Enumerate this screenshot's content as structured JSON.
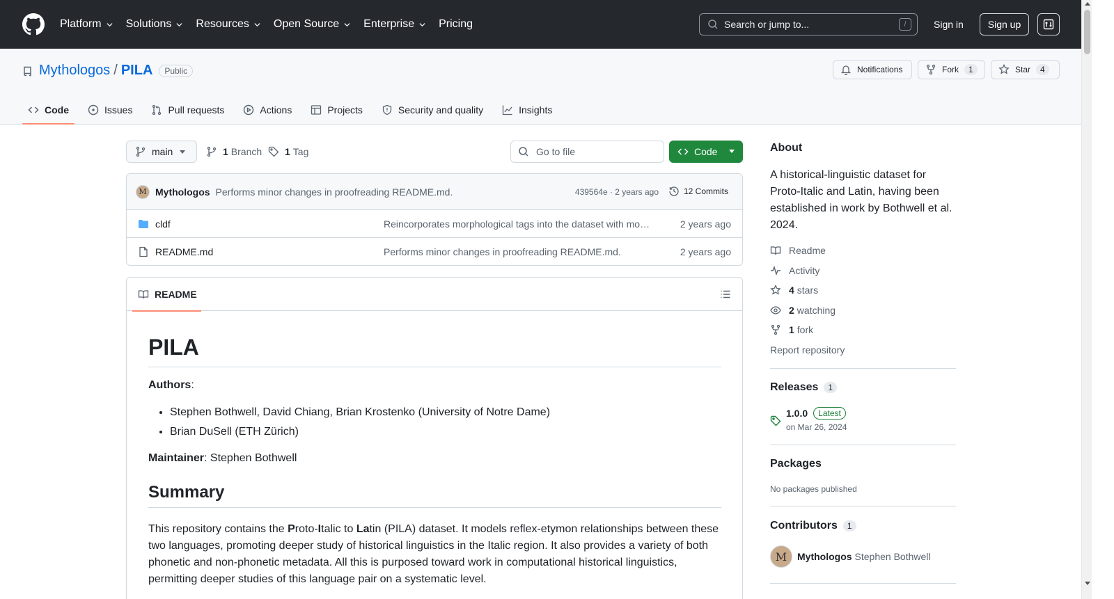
{
  "header": {
    "nav": [
      {
        "label": "Platform",
        "has_dropdown": true
      },
      {
        "label": "Solutions",
        "has_dropdown": true
      },
      {
        "label": "Resources",
        "has_dropdown": true
      },
      {
        "label": "Open Source",
        "has_dropdown": true
      },
      {
        "label": "Enterprise",
        "has_dropdown": true
      },
      {
        "label": "Pricing",
        "has_dropdown": false
      }
    ],
    "search_placeholder": "Search or jump to...",
    "search_shortcut": "/",
    "sign_in": "Sign in",
    "sign_up": "Sign up",
    "icons": {
      "logo": "github-mark-icon",
      "menu": "command-palette-icon"
    }
  },
  "repo": {
    "owner": "Mythologos",
    "separator": "/",
    "name": "PILA",
    "visibility": "Public",
    "notifications_label": "Notifications",
    "fork_label": "Fork",
    "fork_count": "1",
    "star_label": "Star",
    "star_count": "4"
  },
  "tabs": [
    {
      "label": "Code",
      "icon": "code-icon",
      "active": true
    },
    {
      "label": "Issues",
      "icon": "issue-icon",
      "active": false
    },
    {
      "label": "Pull requests",
      "icon": "pull-request-icon",
      "active": false
    },
    {
      "label": "Actions",
      "icon": "play-icon",
      "active": false
    },
    {
      "label": "Projects",
      "icon": "table-icon",
      "active": false
    },
    {
      "label": "Security and quality",
      "icon": "shield-icon",
      "active": false
    },
    {
      "label": "Insights",
      "icon": "graph-icon",
      "active": false
    }
  ],
  "toolbar": {
    "branch": "main",
    "branch_count": "1",
    "branch_label": "Branch",
    "tag_count": "1",
    "tag_label": "Tag",
    "goto_placeholder": "Go to file",
    "code_button": "Code"
  },
  "latest_commit": {
    "author": "Mythologos",
    "message": "Performs minor changes in proofreading README.md.",
    "hash_and_time": "439564e · 2 years ago",
    "commits_label": "12 Commits"
  },
  "files": [
    {
      "name": "cldf",
      "type": "folder",
      "message": "Reincorporates morphological tags into the dataset with more information",
      "date": "2 years ago"
    },
    {
      "name": "README.md",
      "type": "file",
      "message": "Performs minor changes in proofreading README.md.",
      "date": "2 years ago"
    }
  ],
  "readme": {
    "tab_label": "README",
    "h1": "PILA",
    "authors_label": "Authors",
    "authors": [
      "Stephen Bothwell, David Chiang, Brian Krostenko (University of Notre Dame)",
      "Brian DuSell (ETH Zürich)"
    ],
    "maintainer_label": "Maintainer",
    "maintainer": "Stephen Bothwell",
    "h2": "Summary",
    "summary_parts": {
      "a": "This repository contains the ",
      "b1": "P",
      "c1": "roto-",
      "b2": "I",
      "c2": "talic to ",
      "b3": "La",
      "c3": "tin (PILA) dataset. It models reflex-etymon relationships between these two languages, promoting deeper study of historical linguistics in the Italic region. It also provides a variety of both phonetic and non-phonetic metadata. All this is purposed toward work in computational historical linguistics, permitting deeper studies of this language pair on a systematic level."
    }
  },
  "sidebar": {
    "about_title": "About",
    "description": "A historical-linguistic dataset for Proto-Italic and Latin, having been established in work by Bothwell et al. 2024.",
    "links": [
      {
        "icon": "book-icon",
        "bold": "",
        "label": "Readme"
      },
      {
        "icon": "pulse-icon",
        "bold": "",
        "label": "Activity"
      },
      {
        "icon": "star-icon",
        "bold": "4",
        "label": "stars"
      },
      {
        "icon": "eye-icon",
        "bold": "2",
        "label": "watching"
      },
      {
        "icon": "fork-icon",
        "bold": "1",
        "label": "fork"
      }
    ],
    "report": "Report repository",
    "releases_title": "Releases",
    "releases_count": "1",
    "release_version": "1.0.0",
    "release_badge": "Latest",
    "release_date": "on Mar 26, 2024",
    "packages_title": "Packages",
    "packages_empty": "No packages published",
    "contributors_title": "Contributors",
    "contributors_count": "1",
    "contributor_login": "Mythologos",
    "contributor_name": "Stephen Bothwell"
  },
  "colors": {
    "header_bg": "#25292e",
    "link": "#0969da",
    "primary_button": "#1f883d",
    "active_tab_underline": "#fd8c73"
  }
}
